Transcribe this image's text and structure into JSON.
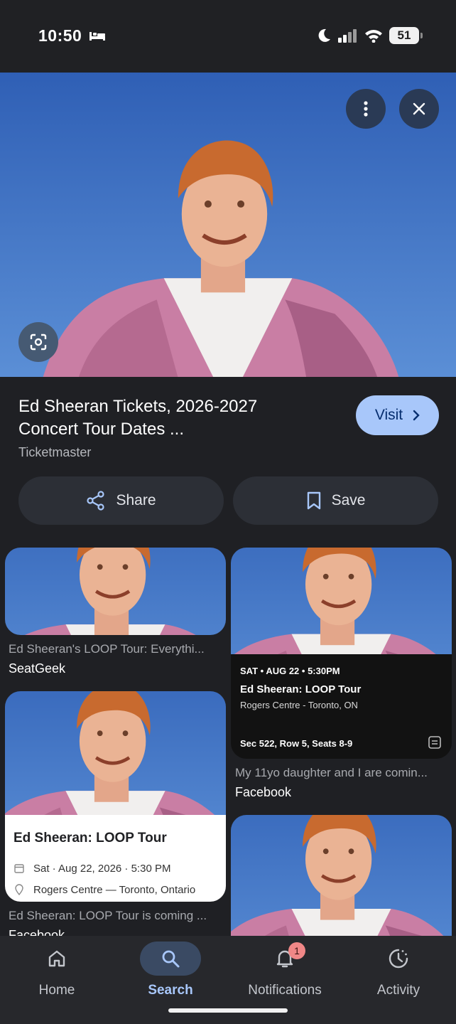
{
  "status_bar": {
    "time": "10:50",
    "battery": "51"
  },
  "hero": {
    "image_alt": "Ed Sheeran in pink jacket against blue sky"
  },
  "result": {
    "title": "Ed Sheeran Tickets, 2026-2027 Concert Tour Dates ...",
    "source": "Ticketmaster",
    "visit_label": "Visit"
  },
  "actions": {
    "share_label": "Share",
    "save_label": "Save"
  },
  "related": [
    {
      "title": "Ed Sheeran's LOOP Tour: Everythi...",
      "source": "SeatGeek"
    },
    {
      "title": "My 11yo daughter and I are comin...",
      "source": "Facebook",
      "ticket": {
        "date": "SAT • AUG 22 • 5:30PM",
        "name": "Ed Sheeran: LOOP Tour",
        "venue": "Rogers Centre - Toronto, ON",
        "seats": "Sec 522, Row 5, Seats 8-9"
      }
    },
    {
      "title": "Ed Sheeran: LOOP Tour is coming ...",
      "source": "Facebook",
      "event": {
        "name": "Ed Sheeran: LOOP Tour",
        "date": "Sat · Aug 22, 2026 · 5:30 PM",
        "venue": "Rogers Centre — Toronto, Ontario"
      }
    }
  ],
  "bottom_nav": {
    "items": [
      {
        "label": "Home",
        "icon": "home-icon"
      },
      {
        "label": "Search",
        "icon": "search-icon",
        "active": true
      },
      {
        "label": "Notifications",
        "icon": "bell-icon",
        "badge": "1"
      },
      {
        "label": "Activity",
        "icon": "history-icon"
      }
    ]
  },
  "colors": {
    "accent": "#a8c7fa",
    "background": "#1f2024",
    "sky": "#3f73c9",
    "jacket": "#c77aa0"
  }
}
